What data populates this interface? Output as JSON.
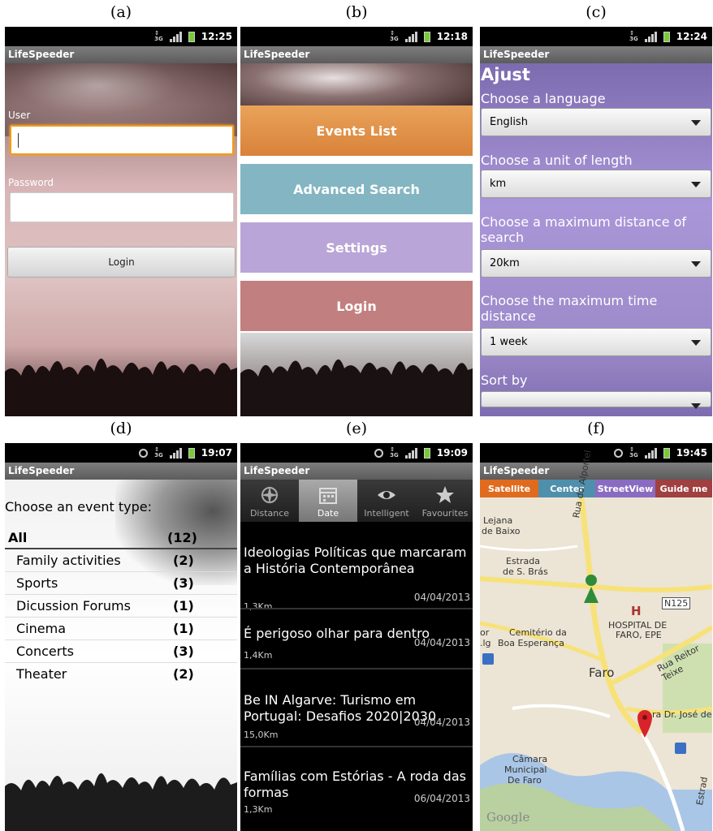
{
  "captions": [
    "(a)",
    "(b)",
    "(c)",
    "(d)",
    "(e)",
    "(f)"
  ],
  "app_title": "LifeSpeeder",
  "colors": {
    "events": "#e08a3c",
    "advanced": "#7fb3c0",
    "settings": "#b8a3d6",
    "login": "#c47e7e",
    "sat": "#e06a1e",
    "center": "#4e8fab",
    "street": "#8a6bc2",
    "guide": "#a04040"
  },
  "panel_a": {
    "time": "12:25",
    "user_label": "User",
    "password_label": "Password",
    "login_button": "Login"
  },
  "panel_b": {
    "time": "12:18",
    "menu": [
      "Events List",
      "Advanced Search",
      "Settings",
      "Login"
    ]
  },
  "panel_c": {
    "time": "12:24",
    "heading": "Ajust",
    "q1": "Choose a language",
    "v1": "English",
    "q2": "Choose a unit of length",
    "v2": "km",
    "q3": "Choose a maximum distance of search",
    "v3": "20km",
    "q4": "Choose the maximum time distance",
    "v4": "1 week",
    "q5": "Sort by"
  },
  "panel_d": {
    "time": "19:07",
    "prompt": "Choose an event type:",
    "types": [
      {
        "name": "All",
        "count": "(12)"
      },
      {
        "name": "Family activities",
        "count": "(2)"
      },
      {
        "name": "Sports",
        "count": "(3)"
      },
      {
        "name": "Dicussion Forums",
        "count": "(1)"
      },
      {
        "name": "Cinema",
        "count": "(1)"
      },
      {
        "name": "Concerts",
        "count": "(3)"
      },
      {
        "name": "Theater",
        "count": "(2)"
      }
    ]
  },
  "panel_e": {
    "time": "19:09",
    "tabs": [
      "Distance",
      "Date",
      "Intelligent",
      "Favourites"
    ],
    "events": [
      {
        "title": "Ideologias Políticas que marcaram a História Contemporânea",
        "date": "04/04/2013",
        "km": "1,3Km"
      },
      {
        "title": " É perigoso olhar para dentro",
        "date": "04/04/2013",
        "km": "1,4Km"
      },
      {
        "title": " Be IN Algarve: Turismo em Portugal: Desafios 2020|2030",
        "date": "04/04/2013",
        "km": "15,0Km"
      },
      {
        "title": " Famílias com Estórias - A roda das formas",
        "date": "06/04/2013",
        "km": "1,3Km"
      }
    ]
  },
  "panel_f": {
    "time": "19:45",
    "buttons": [
      "Satellite",
      "Center",
      "StreetView",
      "Guide me"
    ],
    "labels": {
      "lejana": "Lejana",
      "baixo": "de Baixo",
      "estrada": "Estrada",
      "bras": "de S. Brás",
      "rua_alportel": "Rua do Alportel",
      "n125": "N125",
      "h": "H",
      "hospital": "HOSPITAL DE",
      "faro_epe": "FARO, EPE",
      "cemiterio": "Cemitério da",
      "boa": "Boa Esperança",
      "faro": "Faro",
      "reitor": "Rua Reitor Teixe",
      "jose": "ra Dr. José de",
      "camara": "Câmara",
      "municipal": "Municipal",
      "defaro": "De Faro",
      "google": "Google",
      "estrad": "Estrad",
      "or": "or",
      "lg": ".lg"
    }
  }
}
